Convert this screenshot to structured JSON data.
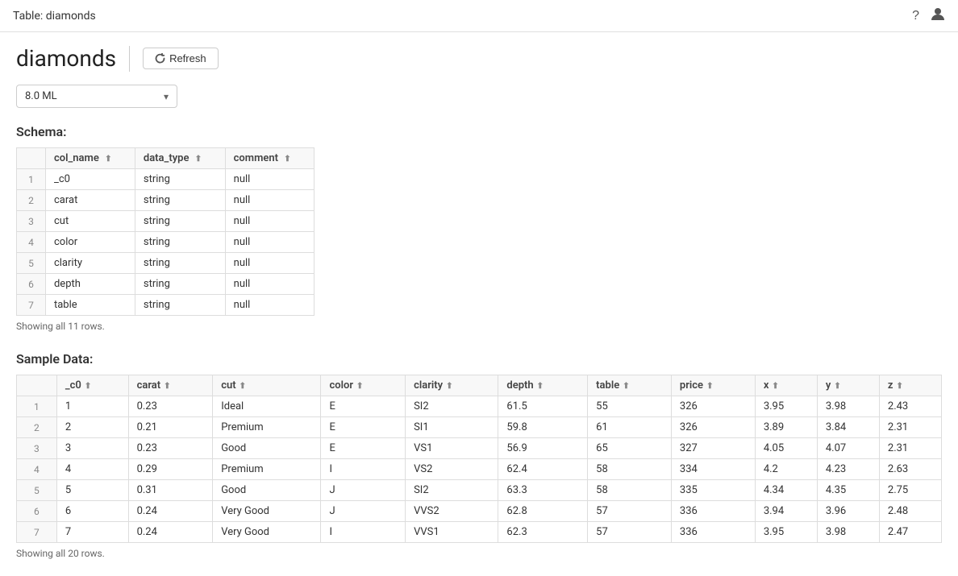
{
  "topBar": {
    "title": "Table: diamonds",
    "helpIcon": "?",
    "userIcon": "👤"
  },
  "pageHeader": {
    "title": "diamonds",
    "refreshLabel": "Refresh"
  },
  "dropdown": {
    "value": "8.0 ML"
  },
  "schema": {
    "sectionTitle": "Schema:",
    "showingText": "Showing all 11 rows.",
    "columns": [
      {
        "key": "row_num",
        "label": ""
      },
      {
        "key": "col_name",
        "label": "col_name"
      },
      {
        "key": "data_type",
        "label": "data_type"
      },
      {
        "key": "comment",
        "label": "comment"
      }
    ],
    "rows": [
      {
        "row_num": "1",
        "col_name": "_c0",
        "data_type": "string",
        "comment": "null"
      },
      {
        "row_num": "2",
        "col_name": "carat",
        "data_type": "string",
        "comment": "null"
      },
      {
        "row_num": "3",
        "col_name": "cut",
        "data_type": "string",
        "comment": "null"
      },
      {
        "row_num": "4",
        "col_name": "color",
        "data_type": "string",
        "comment": "null"
      },
      {
        "row_num": "5",
        "col_name": "clarity",
        "data_type": "string",
        "comment": "null"
      },
      {
        "row_num": "6",
        "col_name": "depth",
        "data_type": "string",
        "comment": "null"
      },
      {
        "row_num": "7",
        "col_name": "table",
        "data_type": "string",
        "comment": "null"
      }
    ]
  },
  "sampleData": {
    "sectionTitle": "Sample Data:",
    "showingText": "Showing all 20 rows.",
    "columns": [
      {
        "key": "row_num",
        "label": ""
      },
      {
        "key": "_c0",
        "label": "_c0"
      },
      {
        "key": "carat",
        "label": "carat"
      },
      {
        "key": "cut",
        "label": "cut"
      },
      {
        "key": "color",
        "label": "color"
      },
      {
        "key": "clarity",
        "label": "clarity"
      },
      {
        "key": "depth",
        "label": "depth"
      },
      {
        "key": "table",
        "label": "table"
      },
      {
        "key": "price",
        "label": "price"
      },
      {
        "key": "x",
        "label": "x"
      },
      {
        "key": "y",
        "label": "y"
      },
      {
        "key": "z",
        "label": "z"
      }
    ],
    "rows": [
      {
        "row_num": "1",
        "_c0": "1",
        "carat": "0.23",
        "cut": "Ideal",
        "color": "E",
        "clarity": "SI2",
        "depth": "61.5",
        "table": "55",
        "price": "326",
        "x": "3.95",
        "y": "3.98",
        "z": "2.43"
      },
      {
        "row_num": "2",
        "_c0": "2",
        "carat": "0.21",
        "cut": "Premium",
        "color": "E",
        "clarity": "SI1",
        "depth": "59.8",
        "table": "61",
        "price": "326",
        "x": "3.89",
        "y": "3.84",
        "z": "2.31"
      },
      {
        "row_num": "3",
        "_c0": "3",
        "carat": "0.23",
        "cut": "Good",
        "color": "E",
        "clarity": "VS1",
        "depth": "56.9",
        "table": "65",
        "price": "327",
        "x": "4.05",
        "y": "4.07",
        "z": "2.31"
      },
      {
        "row_num": "4",
        "_c0": "4",
        "carat": "0.29",
        "cut": "Premium",
        "color": "I",
        "clarity": "VS2",
        "depth": "62.4",
        "table": "58",
        "price": "334",
        "x": "4.2",
        "y": "4.23",
        "z": "2.63"
      },
      {
        "row_num": "5",
        "_c0": "5",
        "carat": "0.31",
        "cut": "Good",
        "color": "J",
        "clarity": "SI2",
        "depth": "63.3",
        "table": "58",
        "price": "335",
        "x": "4.34",
        "y": "4.35",
        "z": "2.75"
      },
      {
        "row_num": "6",
        "_c0": "6",
        "carat": "0.24",
        "cut": "Very Good",
        "color": "J",
        "clarity": "VVS2",
        "depth": "62.8",
        "table": "57",
        "price": "336",
        "x": "3.94",
        "y": "3.96",
        "z": "2.48"
      },
      {
        "row_num": "7",
        "_c0": "7",
        "carat": "0.24",
        "cut": "Very Good",
        "color": "I",
        "clarity": "VVS1",
        "depth": "62.3",
        "table": "57",
        "price": "336",
        "x": "3.95",
        "y": "3.98",
        "z": "2.47"
      }
    ]
  }
}
